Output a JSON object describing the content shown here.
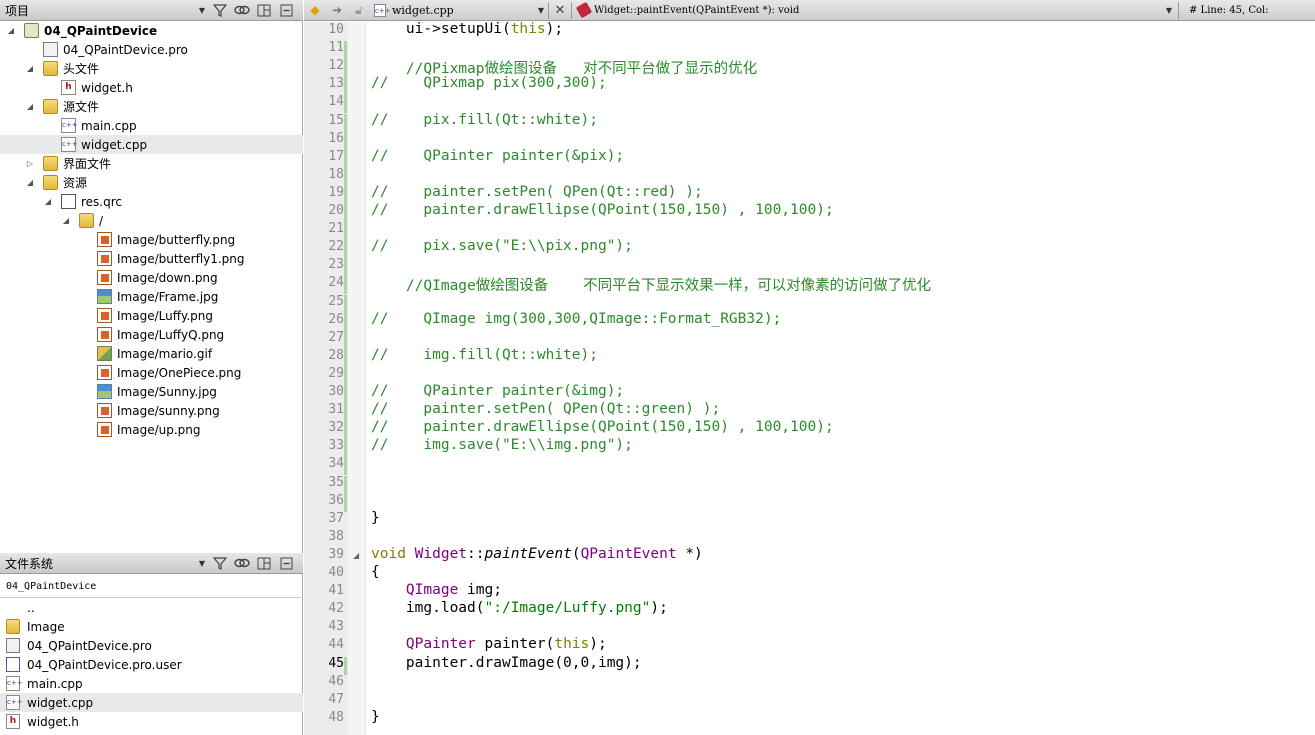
{
  "project_panel": {
    "title": "项目",
    "tree": [
      {
        "label": "04_QPaintDevice",
        "icon": "project-icon",
        "level": 0,
        "expanded": true,
        "bold": true
      },
      {
        "label": "04_QPaintDevice.pro",
        "icon": "pro-file-icon",
        "level": 1
      },
      {
        "label": "头文件",
        "icon": "headers-folder-icon",
        "level": 1,
        "expanded": true
      },
      {
        "label": "widget.h",
        "icon": "header-file-icon",
        "level": 2
      },
      {
        "label": "源文件",
        "icon": "sources-folder-icon",
        "level": 1,
        "expanded": true
      },
      {
        "label": "main.cpp",
        "icon": "cpp-file-icon",
        "level": 2
      },
      {
        "label": "widget.cpp",
        "icon": "cpp-file-icon",
        "level": 2,
        "selected": true
      },
      {
        "label": "界面文件",
        "icon": "forms-folder-icon",
        "level": 1,
        "expanded": false
      },
      {
        "label": "资源",
        "icon": "resources-folder-icon",
        "level": 1,
        "expanded": true
      },
      {
        "label": "res.qrc",
        "icon": "qrc-file-icon",
        "level": 2,
        "expanded": true
      },
      {
        "label": "/",
        "icon": "folder-icon",
        "level": 3,
        "expanded": true
      },
      {
        "label": "Image/butterfly.png",
        "icon": "png-image-icon",
        "level": 4
      },
      {
        "label": "Image/butterfly1.png",
        "icon": "png-image-icon",
        "level": 4
      },
      {
        "label": "Image/down.png",
        "icon": "png-image-icon",
        "level": 4
      },
      {
        "label": "Image/Frame.jpg",
        "icon": "jpg-image-icon",
        "level": 4
      },
      {
        "label": "Image/Luffy.png",
        "icon": "png-image-icon",
        "level": 4
      },
      {
        "label": "Image/LuffyQ.png",
        "icon": "png-image-icon",
        "level": 4
      },
      {
        "label": "Image/mario.gif",
        "icon": "gif-image-icon",
        "level": 4
      },
      {
        "label": "Image/OnePiece.png",
        "icon": "png-image-icon",
        "level": 4
      },
      {
        "label": "Image/Sunny.jpg",
        "icon": "jpg-image-icon",
        "level": 4
      },
      {
        "label": "Image/sunny.png",
        "icon": "png-image-icon",
        "level": 4
      },
      {
        "label": "Image/up.png",
        "icon": "png-image-icon",
        "level": 4
      }
    ]
  },
  "filesystem_panel": {
    "title": "文件系统",
    "path": "04_QPaintDevice",
    "items": [
      {
        "label": "..",
        "icon": ""
      },
      {
        "label": "Image",
        "icon": "folder-icon"
      },
      {
        "label": "04_QPaintDevice.pro",
        "icon": "pro-file-icon"
      },
      {
        "label": "04_QPaintDevice.pro.user",
        "icon": "user-file-icon"
      },
      {
        "label": "main.cpp",
        "icon": "cpp-file-icon"
      },
      {
        "label": "widget.cpp",
        "icon": "cpp-file-icon",
        "selected": true
      },
      {
        "label": "widget.h",
        "icon": "header-file-icon"
      }
    ]
  },
  "editor": {
    "file_name": "widget.cpp",
    "symbol": "Widget::paintEvent(QPaintEvent *): void",
    "position_label": "#  Line: 45, Col:",
    "current_line": 45,
    "lines": [
      {
        "n": 10,
        "s": [
          [
            "    ui->setupUi(",
            ""
          ],
          [
            "this",
            "kw"
          ],
          [
            ");",
            ""
          ]
        ]
      },
      {
        "n": 11,
        "s": []
      },
      {
        "n": 12,
        "s": [
          [
            "    //QPixmap做绘图设备   对不同平台做了显示的优化",
            "cm"
          ]
        ]
      },
      {
        "n": 13,
        "s": [
          [
            "//    QPixmap pix(300,300);",
            "cm"
          ]
        ]
      },
      {
        "n": 14,
        "s": []
      },
      {
        "n": 15,
        "s": [
          [
            "//    pix.fill(Qt::white);",
            "cm"
          ]
        ]
      },
      {
        "n": 16,
        "s": []
      },
      {
        "n": 17,
        "s": [
          [
            "//    QPainter painter(&pix);",
            "cm"
          ]
        ]
      },
      {
        "n": 18,
        "s": []
      },
      {
        "n": 19,
        "s": [
          [
            "//    painter.setPen( QPen(Qt::red) );",
            "cm"
          ]
        ]
      },
      {
        "n": 20,
        "s": [
          [
            "//    painter.drawEllipse(QPoint(150,150) , 100,100);",
            "cm"
          ]
        ]
      },
      {
        "n": 21,
        "s": []
      },
      {
        "n": 22,
        "s": [
          [
            "//    pix.save(\"E:\\\\pix.png\");",
            "cm"
          ]
        ]
      },
      {
        "n": 23,
        "s": []
      },
      {
        "n": 24,
        "s": [
          [
            "    //QImage做绘图设备    不同平台下显示效果一样，可以对像素的访问做了优化",
            "cm"
          ]
        ]
      },
      {
        "n": 25,
        "s": []
      },
      {
        "n": 26,
        "s": [
          [
            "//    QImage img(300,300,QImage::Format_RGB32);",
            "cm"
          ]
        ]
      },
      {
        "n": 27,
        "s": []
      },
      {
        "n": 28,
        "s": [
          [
            "//    img.fill(Qt::white);",
            "cm"
          ]
        ]
      },
      {
        "n": 29,
        "s": []
      },
      {
        "n": 30,
        "s": [
          [
            "//    QPainter painter(&img);",
            "cm"
          ]
        ]
      },
      {
        "n": 31,
        "s": [
          [
            "//    painter.setPen( QPen(Qt::green) );",
            "cm"
          ]
        ]
      },
      {
        "n": 32,
        "s": [
          [
            "//    painter.drawEllipse(QPoint(150,150) , 100,100);",
            "cm"
          ]
        ]
      },
      {
        "n": 33,
        "s": [
          [
            "//    img.save(\"E:\\\\img.png\");",
            "cm"
          ]
        ]
      },
      {
        "n": 34,
        "s": []
      },
      {
        "n": 35,
        "s": []
      },
      {
        "n": 36,
        "s": []
      },
      {
        "n": 37,
        "s": [
          [
            "}",
            ""
          ]
        ]
      },
      {
        "n": 38,
        "s": []
      },
      {
        "n": 39,
        "s": [
          [
            "void",
            "kw"
          ],
          [
            " ",
            ""
          ],
          [
            "Widget",
            "ty"
          ],
          [
            "::",
            ""
          ],
          [
            "paintEvent",
            "it"
          ],
          [
            "(",
            ""
          ],
          [
            "QPaintEvent",
            "ty"
          ],
          [
            " *)",
            ""
          ]
        ]
      },
      {
        "n": 40,
        "s": [
          [
            "{",
            ""
          ]
        ]
      },
      {
        "n": 41,
        "s": [
          [
            "    ",
            ""
          ],
          [
            "QImage",
            "ty"
          ],
          [
            " img;",
            ""
          ]
        ]
      },
      {
        "n": 42,
        "s": [
          [
            "    img.load(",
            ""
          ],
          [
            "\":/Image/Luffy.png\"",
            "st"
          ],
          [
            ");",
            ""
          ]
        ]
      },
      {
        "n": 43,
        "s": []
      },
      {
        "n": 44,
        "s": [
          [
            "    ",
            ""
          ],
          [
            "QPainter",
            "ty"
          ],
          [
            " painter(",
            ""
          ],
          [
            "this",
            "kw"
          ],
          [
            ");",
            ""
          ]
        ]
      },
      {
        "n": 45,
        "s": [
          [
            "    painter.drawImage(0,0,img);",
            ""
          ]
        ]
      },
      {
        "n": 46,
        "s": []
      },
      {
        "n": 47,
        "s": []
      },
      {
        "n": 48,
        "s": [
          [
            "}",
            ""
          ]
        ]
      }
    ]
  }
}
